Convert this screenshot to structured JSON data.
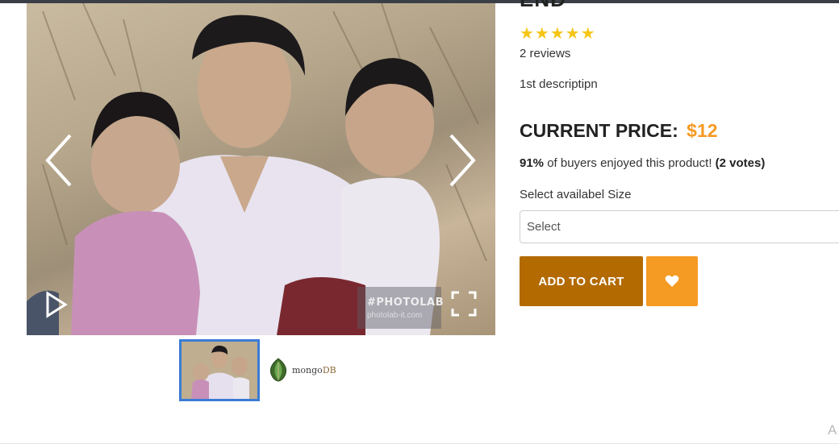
{
  "gallery": {
    "watermark_title": "#PHOTOLAB",
    "watermark_sub": "photolab-it.com",
    "icons": {
      "prev": "chevron-left-icon",
      "next": "chevron-right-icon",
      "play": "play-icon",
      "fullscreen": "fullscreen-icon"
    }
  },
  "thumbnails": {
    "second_logo_word_1": "mongo",
    "second_logo_word_2": "DB"
  },
  "product": {
    "name": "END",
    "stars": "★★★★★",
    "reviews": "2 reviews",
    "description": "1st descriptipn",
    "price_label": "CURRENT PRICE:",
    "price_value": "$12",
    "rating_percent": "91%",
    "rating_text": " of buyers enjoyed this product! ",
    "rating_votes": "(2 votes)",
    "size_label": "Select availabel Size",
    "size_placeholder": "Select",
    "add_to_cart": "ADD TO CART"
  },
  "colors": {
    "accent_orange": "#f59a23",
    "dark_orange": "#b36a00",
    "star_yellow": "#f5c518",
    "thumb_border": "#3a7bd5"
  },
  "corner_text": "A"
}
